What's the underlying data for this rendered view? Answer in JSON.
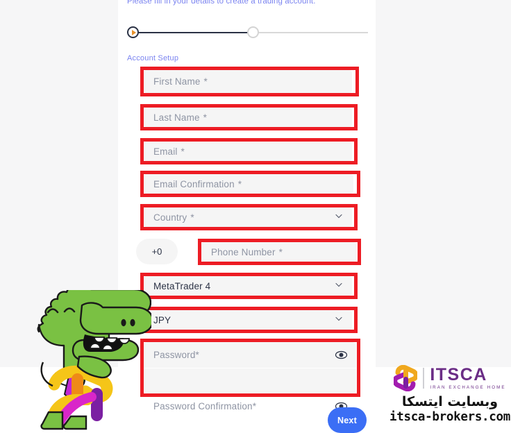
{
  "header": {
    "subtitle": "Please fill in your details to create a trading account."
  },
  "stepper": {
    "current_step": 1,
    "total_steps": 2,
    "section_label": "Account Setup",
    "active_color": "#2b3245",
    "marker_color": "#e8912a",
    "inactive_color": "#d4d4d4"
  },
  "form": {
    "fields": [
      {
        "name": "first-name",
        "placeholder": "First Name",
        "required": "*",
        "value": "",
        "type": "text",
        "highlighted": true
      },
      {
        "name": "last-name",
        "placeholder": "Last Name",
        "required": "*",
        "value": "",
        "type": "text",
        "highlighted": true
      },
      {
        "name": "email",
        "placeholder": "Email",
        "required": "*",
        "value": "",
        "type": "text",
        "highlighted": true
      },
      {
        "name": "email-confirmation",
        "placeholder": "Email Confirmation",
        "required": "*",
        "value": "",
        "type": "text",
        "highlighted": true
      },
      {
        "name": "country",
        "placeholder": "Country",
        "required": "*",
        "value": "",
        "type": "select",
        "highlighted": true
      },
      {
        "name": "phone-number",
        "placeholder": "Phone Number",
        "required": "*",
        "value": "",
        "type": "text",
        "highlighted": true
      },
      {
        "name": "platform",
        "placeholder": "",
        "required": "",
        "value": "MetaTrader 4",
        "type": "select",
        "highlighted": true
      },
      {
        "name": "currency",
        "placeholder": "",
        "required": "",
        "value": "JPY",
        "type": "select",
        "highlighted": true
      }
    ],
    "phone_prefix": "+0",
    "password": {
      "placeholder": "Password",
      "required": "*",
      "value": ""
    },
    "password_confirmation": {
      "placeholder": "Password Confirmation",
      "required": "*",
      "value": ""
    }
  },
  "actions": {
    "next_label": "Next",
    "next_color": "#3b6ef5"
  },
  "watermark": {
    "brand": "ITSCA",
    "tagline": "IRAN EXCHANGE HOME",
    "persian": "وبسایت ایتسکا",
    "url": "itsca-brokers.com",
    "brand_color": "#6b2d86"
  },
  "theme": {
    "highlight_color": "#ed1c24",
    "field_bg": "#f5f5f5",
    "page_bg": "#f6f6f7",
    "card_bg": "#ffffff",
    "accent_text": "#7b84f0"
  }
}
